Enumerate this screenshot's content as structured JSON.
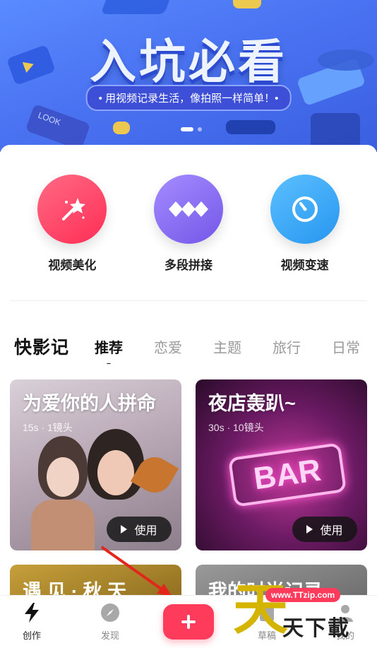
{
  "banner": {
    "title": "入坑必看",
    "subtitle": "• 用视频记录生活，像拍照一样简单！•",
    "deco_text": "LOOK"
  },
  "tools": [
    {
      "label": "视频美化",
      "icon": "magic-wand-icon",
      "color": "#ff4466"
    },
    {
      "label": "多段拼接",
      "icon": "diamond-chain-icon",
      "color": "#8a6cf0"
    },
    {
      "label": "视频变速",
      "icon": "speedometer-icon",
      "color": "#3aa8f8"
    }
  ],
  "tabs": {
    "logo": "快影记",
    "items": [
      "推荐",
      "恋爱",
      "主题",
      "旅行",
      "日常"
    ],
    "active": "推荐"
  },
  "cards": [
    {
      "title": "为爱你的人拼命",
      "meta": "15s · 1镜头",
      "use_label": "使用"
    },
    {
      "title": "夜店轰趴~",
      "meta": "30s · 10镜头",
      "use_label": "使用",
      "neon": "BAR"
    },
    {
      "title": "遇 见 · 秋 天"
    },
    {
      "title": "我的时尚记录"
    }
  ],
  "nav": {
    "items": [
      {
        "label": "创作",
        "icon": "lightning-icon"
      },
      {
        "label": "发现",
        "icon": "compass-icon"
      },
      {
        "label": "草稿",
        "icon": "draft-icon"
      },
      {
        "label": "我的",
        "icon": "user-icon"
      }
    ],
    "fab_icon": "plus-icon"
  },
  "watermark": {
    "url": "www.TTzip.com",
    "glyph": "天",
    "text": "天下載"
  },
  "colors": {
    "accent": "#ff3b5c",
    "banner": "#4a73f2"
  }
}
